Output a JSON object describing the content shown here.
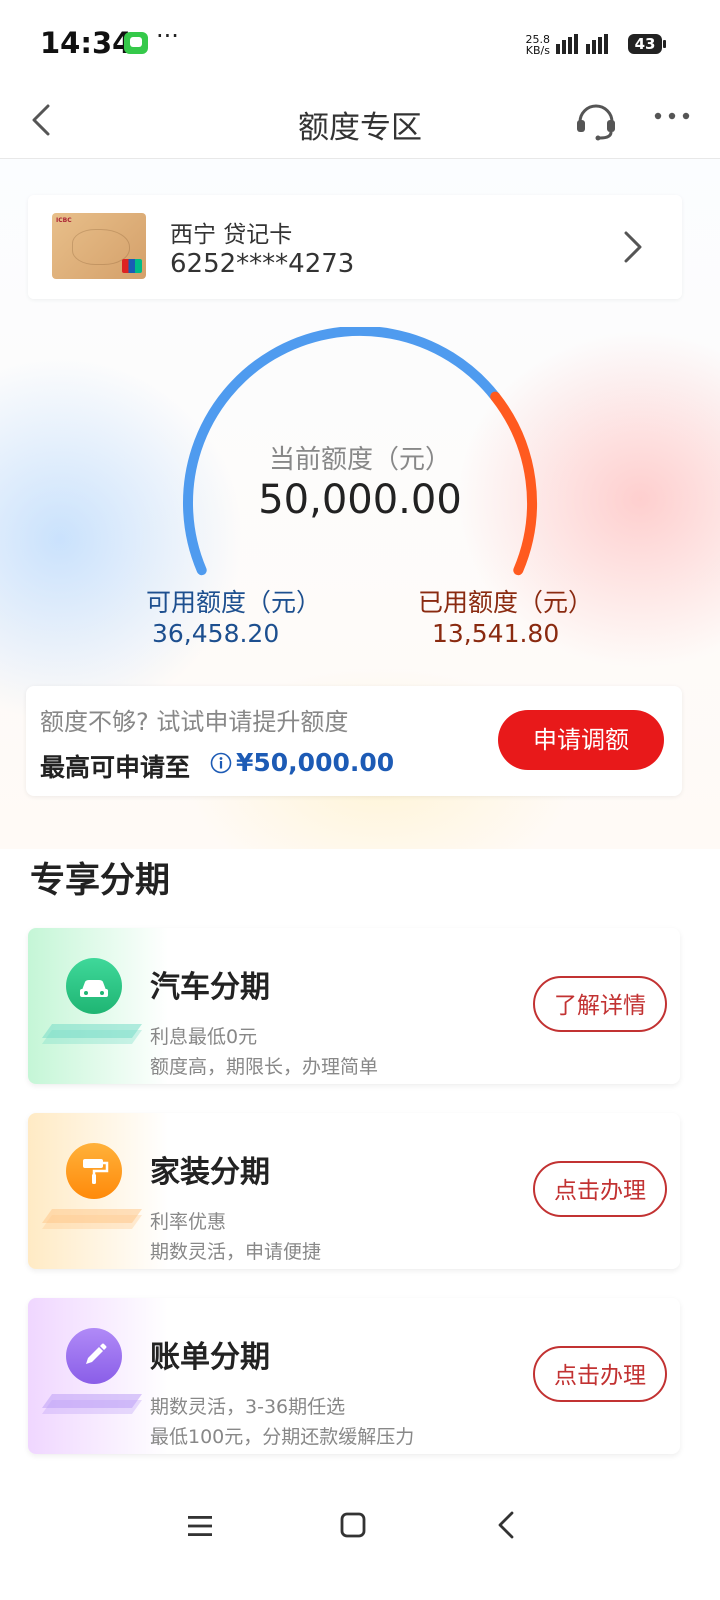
{
  "status_bar": {
    "time": "14:34",
    "more": "···",
    "net_speed_value": "25.8",
    "net_speed_unit": "KB/s",
    "battery": "43"
  },
  "app_bar": {
    "title": "额度专区"
  },
  "card": {
    "name": "西宁 贷记卡",
    "number": "6252****4273"
  },
  "credit": {
    "current_label": "当前额度（元）",
    "current_value": "50,000.00",
    "available_label": "可用额度（元）",
    "available_value": "36,458.20",
    "used_label": "已用额度（元）",
    "used_value": "13,541.80",
    "used_fraction": 0.2708,
    "available_color": "#4f9bef",
    "used_color": "#ff5a1f"
  },
  "raise": {
    "hint": "额度不够? 试试申请提升额度",
    "max_label": "最高可申请至",
    "max_amount": "¥50,000.00",
    "button": "申请调额"
  },
  "section": {
    "title": "专享分期"
  },
  "promos": [
    {
      "title": "汽车分期",
      "line1": "利息最低0元",
      "line2": "额度高，期限长，办理简单",
      "button": "了解详情",
      "icon": "car-icon",
      "color": "#2ecb8a"
    },
    {
      "title": "家装分期",
      "line1": "利率优惠",
      "line2": "期数灵活，申请便捷",
      "button": "点击办理",
      "icon": "paint-roller-icon",
      "color": "#ff9a1a"
    },
    {
      "title": "账单分期",
      "line1": "期数灵活，3-36期任选",
      "line2": "最低100元，分期还款缓解压力",
      "button": "点击办理",
      "icon": "pencil-icon",
      "color": "#9b6cf2"
    }
  ]
}
